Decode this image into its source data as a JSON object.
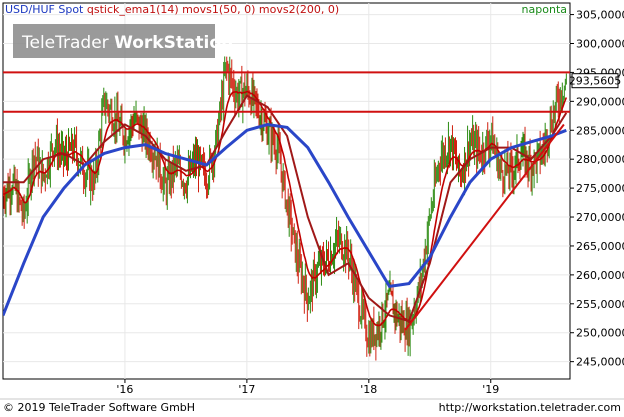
{
  "header": {
    "instrument": "USD/HUF Spot",
    "indicators": "qstick_ema1(14) movs1(50, 0) movs2(200, 0)",
    "timeframe": "naponta"
  },
  "branding": {
    "logo_text_light": "TeleTrader",
    "logo_text_bold": "WorkStation"
  },
  "footer": {
    "copyright": "© 2019 TeleTrader Software GmbH",
    "url": "http://workstation.teletrader.com"
  },
  "colors": {
    "qstick": "#c00000",
    "ma50": "#a01818",
    "ma200": "#2a46c8",
    "up_candle": "#2a8a10",
    "down_candle": "#d02010",
    "level_lines": "#d01010",
    "trendline": "#d01010",
    "price_box": "#ffffff"
  },
  "chart_data": {
    "type": "line",
    "title": "USD/HUF Spot",
    "x_ticks": [
      "'16",
      "'17",
      "'18",
      "'19"
    ],
    "y_ticks": [
      "245,0000",
      "250,0000",
      "255,0000",
      "260,0000",
      "265,0000",
      "270,0000",
      "275,0000",
      "280,0000",
      "285,0000",
      "290,0000",
      "295,0000",
      "300,0000",
      "305,0000"
    ],
    "ylim": [
      242,
      307
    ],
    "xlim": [
      2015.0,
      2019.65
    ],
    "last_price_label": "293,5605",
    "horizontal_levels": [
      295.0,
      288.2
    ],
    "trendline": {
      "from": [
        2018.3,
        250.5
      ],
      "to": [
        2019.6,
        286.0
      ]
    },
    "price": {
      "x": [
        2015.0,
        2015.08,
        2015.17,
        2015.25,
        2015.33,
        2015.42,
        2015.5,
        2015.58,
        2015.67,
        2015.75,
        2015.83,
        2015.92,
        2016.0,
        2016.08,
        2016.17,
        2016.25,
        2016.33,
        2016.42,
        2016.5,
        2016.58,
        2016.67,
        2016.75,
        2016.83,
        2016.92,
        2017.0,
        2017.08,
        2017.17,
        2017.25,
        2017.33,
        2017.42,
        2017.5,
        2017.58,
        2017.67,
        2017.75,
        2017.83,
        2017.92,
        2018.0,
        2018.08,
        2018.17,
        2018.25,
        2018.33,
        2018.42,
        2018.5,
        2018.58,
        2018.67,
        2018.75,
        2018.83,
        2018.92,
        2019.0,
        2019.08,
        2019.17,
        2019.25,
        2019.33,
        2019.42,
        2019.5,
        2019.58,
        2019.62
      ],
      "y": [
        274,
        276,
        270,
        281,
        277,
        283,
        280,
        282,
        278,
        276,
        290,
        287,
        284,
        287,
        284,
        281,
        275,
        279,
        276,
        280,
        277,
        283,
        296,
        291,
        292,
        289,
        285,
        282,
        272,
        262,
        256,
        261,
        263,
        266,
        264,
        255,
        249,
        251,
        256,
        252,
        251,
        258,
        270,
        280,
        283,
        277,
        283,
        281,
        284,
        278,
        278,
        281,
        279,
        281,
        287,
        292,
        293.56
      ]
    },
    "ma50": {
      "x": [
        2015.0,
        2015.17,
        2015.33,
        2015.5,
        2015.67,
        2015.83,
        2016.0,
        2016.17,
        2016.33,
        2016.5,
        2016.67,
        2016.83,
        2017.0,
        2017.17,
        2017.33,
        2017.5,
        2017.67,
        2017.83,
        2018.0,
        2018.17,
        2018.33,
        2018.5,
        2018.67,
        2018.83,
        2019.0,
        2019.17,
        2019.33,
        2019.5,
        2019.62
      ],
      "y": [
        276,
        276,
        280,
        281,
        279,
        283,
        286,
        284,
        280,
        278,
        279,
        285,
        291,
        289,
        284,
        270,
        260,
        262,
        256,
        253,
        252,
        262,
        276,
        280,
        282,
        282,
        280,
        284,
        288
      ]
    },
    "ma200": {
      "x": [
        2015.0,
        2015.17,
        2015.33,
        2015.5,
        2015.67,
        2015.83,
        2016.0,
        2016.17,
        2016.33,
        2016.5,
        2016.67,
        2016.83,
        2017.0,
        2017.17,
        2017.33,
        2017.5,
        2017.67,
        2017.83,
        2018.0,
        2018.17,
        2018.33,
        2018.5,
        2018.67,
        2018.83,
        2019.0,
        2019.17,
        2019.33,
        2019.5,
        2019.62
      ],
      "y": [
        253,
        262,
        270,
        275,
        279,
        281,
        282,
        282.5,
        281,
        280,
        279,
        282,
        285,
        286,
        285.5,
        282,
        276,
        270,
        264,
        258,
        258.5,
        263,
        270,
        276,
        280,
        282,
        283,
        284,
        285
      ]
    }
  }
}
